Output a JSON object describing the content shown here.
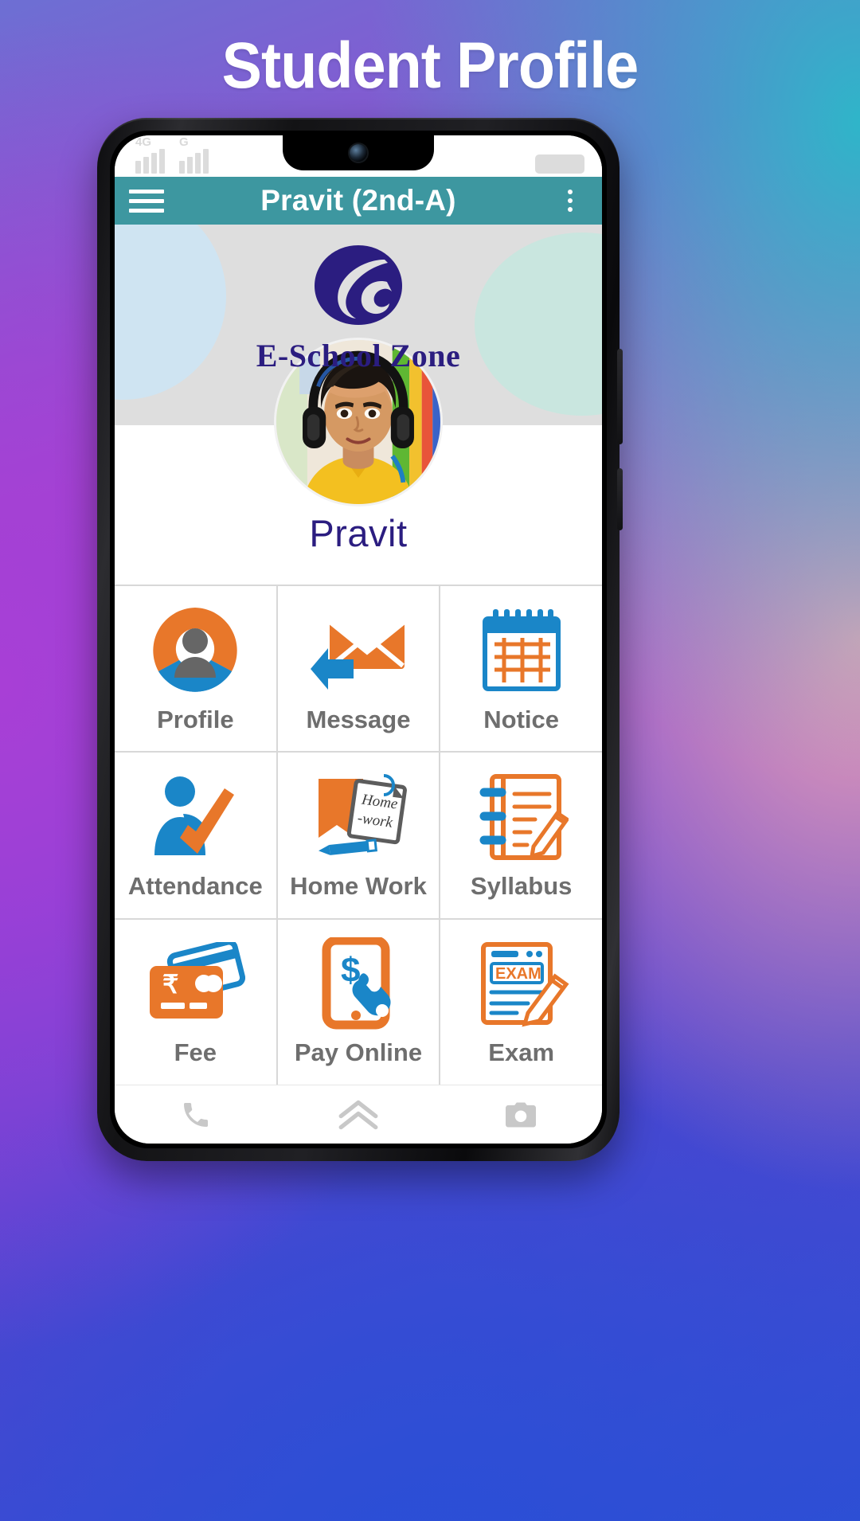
{
  "poster": {
    "title": "Student Profile",
    "background_colors": [
      "#6d6fd3",
      "#9a46cf",
      "#2fb5c9",
      "#e8a0b4",
      "#2e4fd4"
    ]
  },
  "phone": {
    "status_bar": {
      "network_primary": "4G",
      "network_secondary": "G",
      "signal_bars_primary": 4,
      "signal_bars_secondary": 4,
      "battery_icon": "battery-icon"
    },
    "app_bar": {
      "menu_icon": "hamburger-menu-icon",
      "title": "Pravit (2nd-A)",
      "overflow_icon": "more-vertical-icon",
      "background_color": "#3d97a0",
      "text_color": "#ffffff"
    },
    "brand": {
      "logo_icon": "e-school-zone-logo-icon",
      "name": "E-School Zone",
      "name_color": "#2b1d80",
      "background_color": "#dedede"
    },
    "profile": {
      "avatar_icon": "student-avatar",
      "student_name": "Pravit",
      "name_color": "#2b1d80"
    },
    "grid": {
      "accent_orange": "#e8772a",
      "accent_blue": "#1a86c8",
      "label_color": "#6e6e6e",
      "tiles": [
        {
          "label": "Profile",
          "icon": "profile-icon"
        },
        {
          "label": "Message",
          "icon": "message-envelope-icon"
        },
        {
          "label": "Notice",
          "icon": "notice-calendar-icon"
        },
        {
          "label": "Attendance",
          "icon": "attendance-check-icon"
        },
        {
          "label": "Home Work",
          "icon": "home-work-icon"
        },
        {
          "label": "Syllabus",
          "icon": "syllabus-icon"
        },
        {
          "label": "Fee",
          "icon": "fee-card-icon"
        },
        {
          "label": "Pay Online",
          "icon": "pay-online-icon"
        },
        {
          "label": "Exam",
          "icon": "exam-icon"
        }
      ],
      "home_work_note_line1": "Home",
      "home_work_note_line2": "-work",
      "exam_label_on_icon": "EXAM",
      "fee_currency_symbol": "₹",
      "pay_currency_symbol": "$"
    },
    "bottom_nav": [
      {
        "icon": "phone-call-icon"
      },
      {
        "icon": "chevron-double-up-icon"
      },
      {
        "icon": "camera-icon"
      }
    ]
  }
}
